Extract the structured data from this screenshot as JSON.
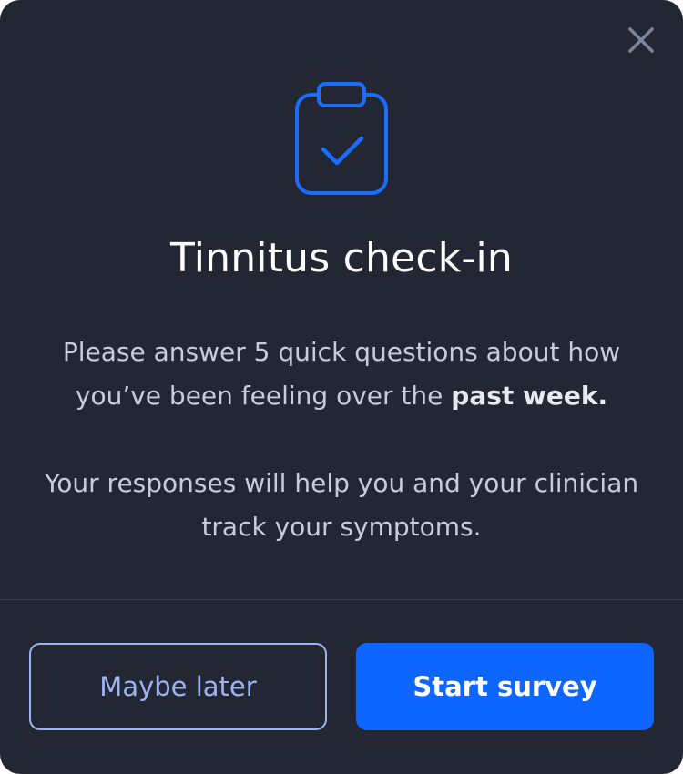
{
  "dialog": {
    "title": "Tinnitus check-in",
    "intro_prefix": "Please answer 5 quick questions about how you’ve been feeling over the ",
    "intro_emphasis": "past week.",
    "note": "Your responses will help you and your clinician track your symptoms.",
    "close_icon": "close-icon",
    "header_icon": "clipboard-check-icon"
  },
  "actions": {
    "secondary_label": "Maybe later",
    "primary_label": "Start survey"
  },
  "colors": {
    "background": "#232733",
    "accent": "#0d66ff",
    "secondary_text": "#9db4f2",
    "icon_blue": "#1a6dff",
    "close_icon": "#7c8599"
  }
}
